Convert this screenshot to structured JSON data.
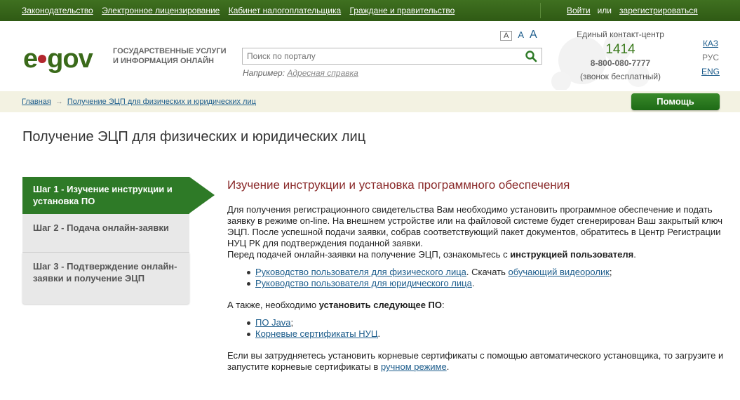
{
  "topbar": {
    "links": [
      "Законодательство",
      "Электронное лицензирование",
      "Кабинет налогоплательщика",
      "Граждане и правительство"
    ],
    "login": "Войти",
    "or": "или",
    "register": "зарегистрироваться"
  },
  "header": {
    "logo_left": "e",
    "logo_right": "gov",
    "logo_text_1": "ГОСУДАРСТВЕННЫЕ УСЛУГИ",
    "logo_text_2": "И ИНФОРМАЦИЯ ОНЛАЙН",
    "search_placeholder": "Поиск по порталу",
    "example_label": "Например:",
    "example_link": "Адресная справка",
    "font_sizes": [
      "A",
      "A",
      "A"
    ],
    "contact_title": "Единый контакт-центр",
    "contact_number": "1414",
    "contact_phone": "8-800-080-7777",
    "contact_free": "(звонок бесплатный)",
    "langs": [
      "КАЗ",
      "РУС",
      "ENG"
    ]
  },
  "breadcrumb": {
    "home": "Главная",
    "arrow": "→",
    "current": "Получение ЭЦП для физических и юридических лиц",
    "help_button": "Помощь"
  },
  "page": {
    "title": "Получение ЭЦП для физических и юридических лиц"
  },
  "steps": [
    {
      "label": "Шаг 1 - Изучение инструкции и установка ПО",
      "active": true
    },
    {
      "label": "Шаг 2 - Подача онлайн-заявки",
      "active": false
    },
    {
      "label": "Шаг 3 - Подтверждение онлайн-заявки и получение ЭЦП",
      "active": false
    }
  ],
  "content": {
    "heading": "Изучение инструкции и установка программного обеспечения",
    "para1": "Для получения регистрационного свидетельства Вам необходимо установить программное обеспечение и подать заявку в режиме on-line. На внешнем устройстве или на файловой системе будет сгенерирован Ваш закрытый ключ ЭЦП. После успешной подачи заявки, собрав соответствующий пакет документов, обратитесь в Центр Регистрации НУЦ РК для подтверждения поданной заявки.",
    "para2_pre": "Перед подачей онлайн-заявки на получение ЭЦП, ознакомьтесь с ",
    "para2_bold": "инструкцией пользователя",
    "para2_post": ".",
    "guide_phys": "Руководство пользователя для физического лица",
    "download_text": ". Скачать ",
    "video_link": "обучающий видеоролик",
    "semicolon": ";",
    "guide_legal": "Руководство пользователя для юридического лица",
    "period": ".",
    "also_pre": "А также, необходимо ",
    "also_bold": "установить следующее ПО",
    "also_post": ":",
    "java_link": "ПО Java",
    "root_certs_link": "Корневые сертификаты НУЦ",
    "final_pre": "Если вы затрудняетесь установить корневые сертификаты с помощью автоматического установщика, то загрузите и запустите корневые сертификаты в ",
    "manual_link": "ручном режиме",
    "final_post": "."
  },
  "colors": {
    "topbar": "#3c6b1d",
    "accent_green": "#2e7a27",
    "heading_red": "#8a2a2a",
    "link_blue": "#1d5d8c",
    "crumb_bg": "#f3f2e2"
  }
}
